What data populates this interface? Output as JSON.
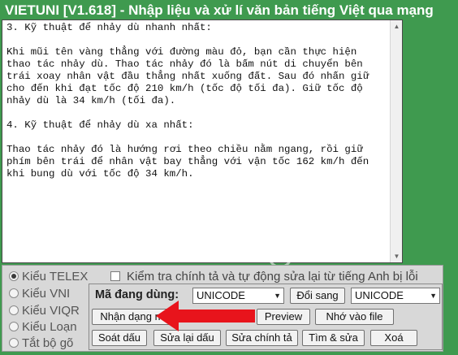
{
  "window": {
    "title": "VIETUNI [V1.618] - Nhập liệu và xử lí văn bản tiếng Việt qua mạng"
  },
  "editor": {
    "text": "3. Kỹ thuật để nhảy dù nhanh nhất:\n\nKhi mũi tên vàng thẳng với đường màu đỏ, bạn cần thực hiện thao tác nhảy dù. Thao tác nhảy đó là bấm nút di chuyển bên trái xoay nhân vật đầu thẳng nhất xuống đất. Sau đó nhấn giữ cho đến khi đạt tốc độ 210 km/h (tốc độ tối đa). Giữ tốc độ nhảy dù là 34 km/h (tối đa).\n\n4. Kỹ thuật để nhảy dù xa nhất:\n\nThao tác nhảy đó là hướng rơi theo chiều nằm ngang, rồi giữ phím bên trái để nhân vật bay thẳng với vận tốc 162 km/h đến khi bung dù với tốc độ 34 km/h."
  },
  "input_methods": [
    {
      "label": "Kiểu TELEX",
      "selected": true
    },
    {
      "label": "Kiểu VNI",
      "selected": false
    },
    {
      "label": "Kiểu VIQR",
      "selected": false
    },
    {
      "label": "Kiểu Loạn",
      "selected": false
    },
    {
      "label": "Tắt bộ gõ",
      "selected": false
    }
  ],
  "spellcheck": {
    "label": "Kiểm tra chính tả và tự động sửa lại từ tiếng Anh bị lỗi",
    "checked": false
  },
  "encoding": {
    "label": "Mã đang dùng:",
    "current": "UNICODE",
    "convert_button": "Đổi sang",
    "target": "UNICODE"
  },
  "actions": {
    "detect": "Nhận dạng mã",
    "preview": "Preview",
    "save_file": "Nhớ vào file",
    "check_marks": "Soát dấu",
    "fix_marks": "Sửa lại dấu",
    "fix_spelling": "Sửa chính tả",
    "find_replace": "Tìm & sửa",
    "delete": "Xoá"
  },
  "watermark": {
    "text": "uantrimang"
  },
  "colors": {
    "title_bar": "#3f9a4f",
    "panel": "#d8d8d8",
    "highlight_arrow": "#e8141c"
  }
}
